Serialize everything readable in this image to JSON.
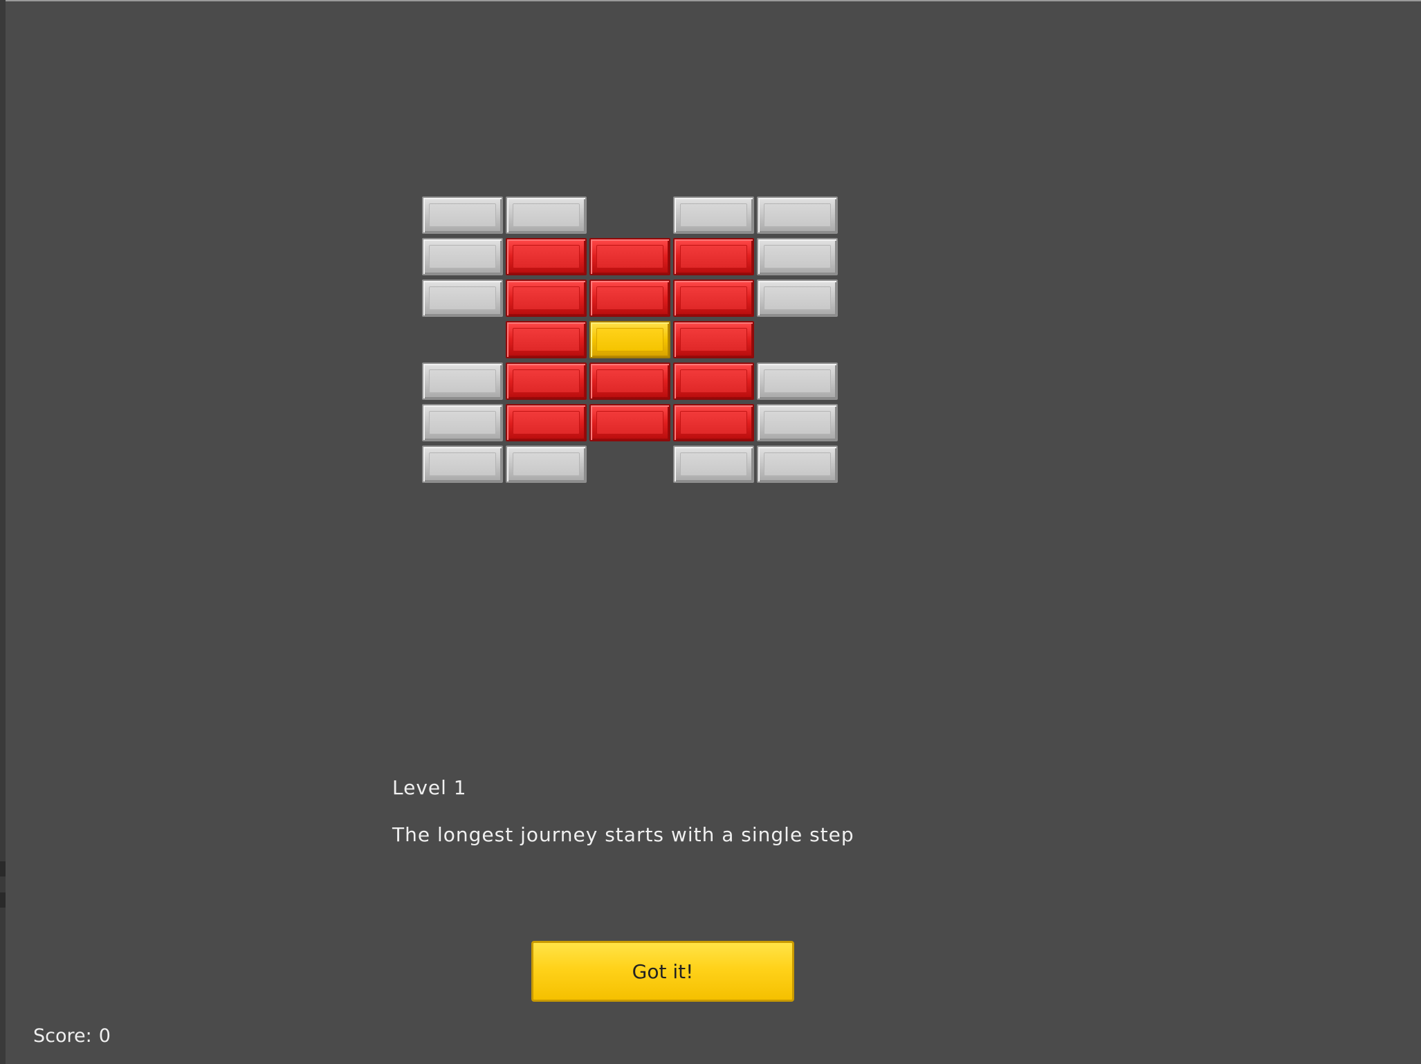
{
  "level": {
    "title": "Level 1",
    "message": "The longest journey starts with a single step"
  },
  "button": {
    "label": "Got it!"
  },
  "score": {
    "label": "Score:",
    "value": "0"
  },
  "colors": {
    "background": "#4b4b4b",
    "gray_brick": "#c8c8c8",
    "red_brick": "#e02626",
    "yellow_brick": "#f5c400",
    "button": "#ffd21a"
  },
  "brick_layout": [
    [
      "gray",
      "gray",
      null,
      "gray",
      "gray"
    ],
    [
      "gray",
      "red",
      "red",
      "red",
      "gray"
    ],
    [
      "gray",
      "red",
      "red",
      "red",
      "gray"
    ],
    [
      null,
      "red",
      "yellow",
      "red",
      null
    ],
    [
      "gray",
      "red",
      "red",
      "red",
      "gray"
    ],
    [
      "gray",
      "red",
      "red",
      "red",
      "gray"
    ],
    [
      "gray",
      "gray",
      null,
      "gray",
      "gray"
    ]
  ]
}
